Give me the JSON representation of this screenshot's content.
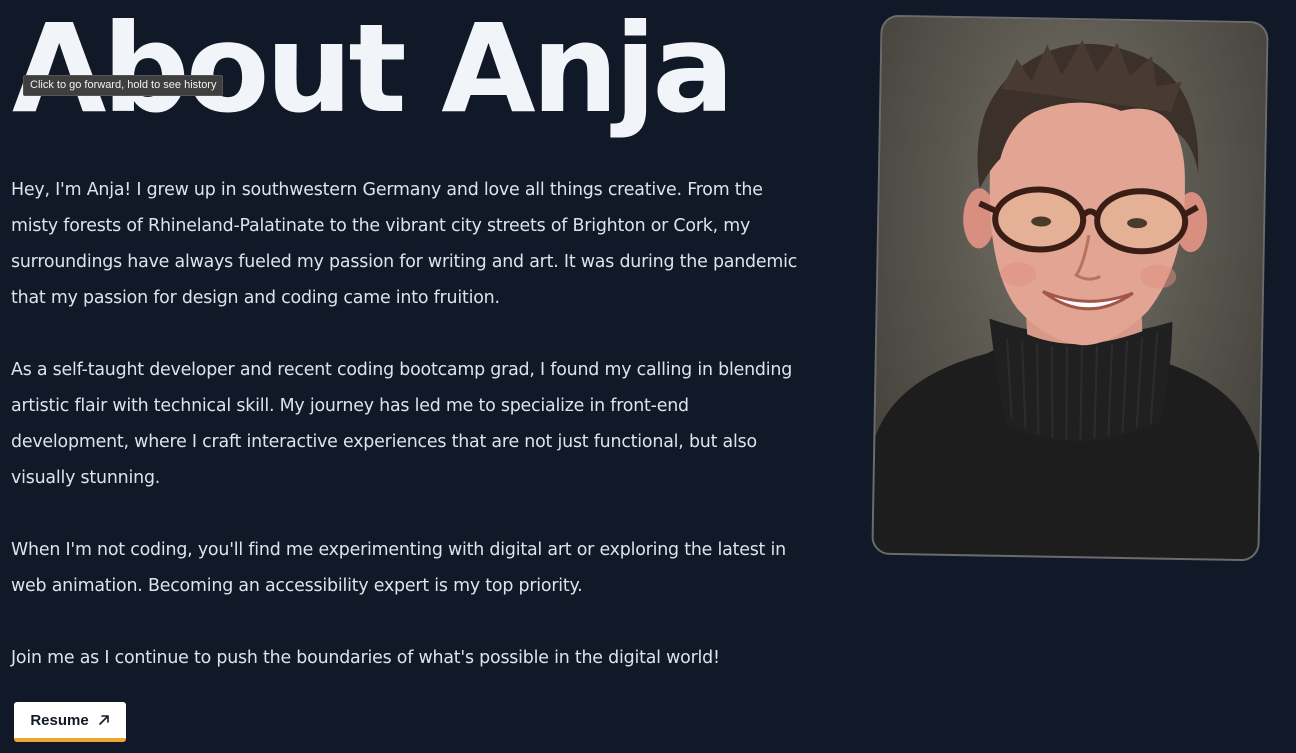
{
  "header": {
    "title": "About Anja"
  },
  "tooltip": {
    "text": "Click to go forward, hold to see history"
  },
  "bio": {
    "paragraphs": [
      "Hey, I'm Anja! I grew up in southwestern Germany and love all things creative. From the misty forests of Rhineland-Palatinate to the vibrant city streets of Brighton or Cork, my surroundings have always fueled my passion for writing and art. It was during the pandemic that my passion for design and coding came into fruition.",
      "As a self-taught developer and recent coding bootcamp grad, I found my calling in blending artistic flair with technical skill. My journey has led me to specialize in front-end development, where I craft interactive experiences that are not just functional, but also visually stunning.",
      "When I'm not coding, you'll find me experimenting with digital art or exploring the latest in web animation. Becoming an accessibility expert is my top priority.",
      "Join me as I continue to push the boundaries of what's possible in the digital world!"
    ]
  },
  "resume": {
    "label": "Resume",
    "icon": "arrow-up-right-icon"
  },
  "colors": {
    "background": "#111827",
    "title": "#f1f5f9",
    "text": "#dde3ec",
    "button_bg": "#ffffff",
    "button_accent": "#f0a531"
  }
}
